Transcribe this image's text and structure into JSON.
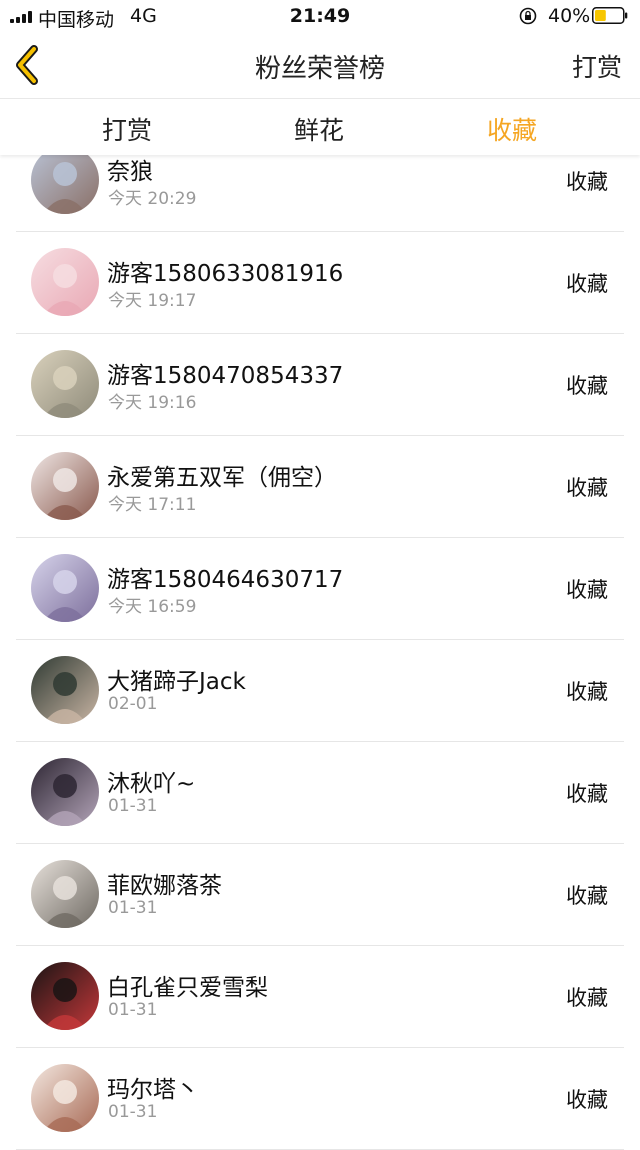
{
  "status_bar": {
    "carrier": "中国移动",
    "network": "4G",
    "time": "21:49",
    "battery_percent": "40%",
    "battery_level": 0.4,
    "battery_color": "#f7c600",
    "lock_icon": "orientation-lock-icon"
  },
  "header": {
    "back_icon": "chevron-left-icon",
    "title": "粉丝荣誉榜",
    "right_action": "打赏"
  },
  "tabs": [
    {
      "label": "打赏",
      "active": false
    },
    {
      "label": "鲜花",
      "active": false
    },
    {
      "label": "收藏",
      "active": true
    }
  ],
  "accent_color": "#f5a623",
  "fans": [
    {
      "name": "奈狼",
      "time": "今天 20:29",
      "action": "收藏",
      "avatar_colors": [
        "#b9c3d6",
        "#8a6f66"
      ]
    },
    {
      "name": "游客1580633081916",
      "time": "今天 19:17",
      "action": "收藏",
      "avatar_colors": [
        "#f6dde1",
        "#e9a8b4"
      ]
    },
    {
      "name": "游客1580470854337",
      "time": "今天 19:16",
      "action": "收藏",
      "avatar_colors": [
        "#d9d1bc",
        "#8f8b7a"
      ]
    },
    {
      "name": "永爱第五双军（佣空）",
      "time": "今天 17:11",
      "action": "收藏",
      "avatar_colors": [
        "#efe6e4",
        "#8a5a4e"
      ]
    },
    {
      "name": "游客1580464630717",
      "time": "今天 16:59",
      "action": "收藏",
      "avatar_colors": [
        "#d6d3ea",
        "#7d6f9c"
      ]
    },
    {
      "name": "大猪蹄子Jack",
      "time": "02-01",
      "action": "收藏",
      "avatar_colors": [
        "#2f3a33",
        "#c9b5a4"
      ]
    },
    {
      "name": "沐秋吖~",
      "time": "01-31",
      "action": "收藏",
      "avatar_colors": [
        "#2d2633",
        "#b3a4b8"
      ]
    },
    {
      "name": "菲欧娜落茶",
      "time": "01-31",
      "action": "收藏",
      "avatar_colors": [
        "#e6e0da",
        "#6f6a63"
      ]
    },
    {
      "name": "白孔雀只爱雪梨",
      "time": "01-31",
      "action": "收藏",
      "avatar_colors": [
        "#1a1414",
        "#c4383a"
      ]
    },
    {
      "name": "玛尔塔丶",
      "time": "01-31",
      "action": "收藏",
      "avatar_colors": [
        "#f3e7df",
        "#a86a55"
      ]
    }
  ]
}
